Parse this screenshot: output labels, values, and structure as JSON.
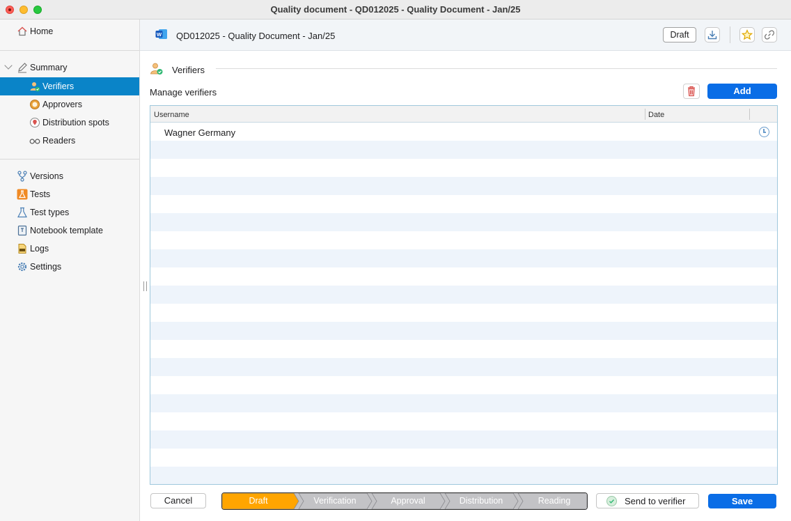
{
  "window": {
    "title": "Quality document - QD012025 - Quality Document - Jan/25"
  },
  "sidebar": {
    "home": "Home",
    "summary": "Summary",
    "sub_items": [
      "Verifiers",
      "Approvers",
      "Distribution spots",
      "Readers"
    ],
    "items": [
      "Versions",
      "Tests",
      "Test types",
      "Notebook template",
      "Logs",
      "Settings"
    ]
  },
  "header": {
    "doc_title": "QD012025 - Quality Document - Jan/25",
    "status_badge": "Draft"
  },
  "section": {
    "title": "Verifiers",
    "manage_label": "Manage verifiers",
    "add_label": "Add"
  },
  "table": {
    "columns": [
      "Username",
      "Date"
    ],
    "rows": [
      {
        "username": "Wagner Germany",
        "date": ""
      }
    ]
  },
  "footer": {
    "cancel_label": "Cancel",
    "workflow": [
      "Draft",
      "Verification",
      "Approval",
      "Distribution",
      "Reading"
    ],
    "workflow_active": 0,
    "send_label": "Send to verifier",
    "save_label": "Save"
  },
  "colors": {
    "accent": "#0a6de6",
    "active_step": "#ffa500",
    "inactive_step": "#c3c3c6",
    "sidebar_selected": "#0a84c8"
  }
}
